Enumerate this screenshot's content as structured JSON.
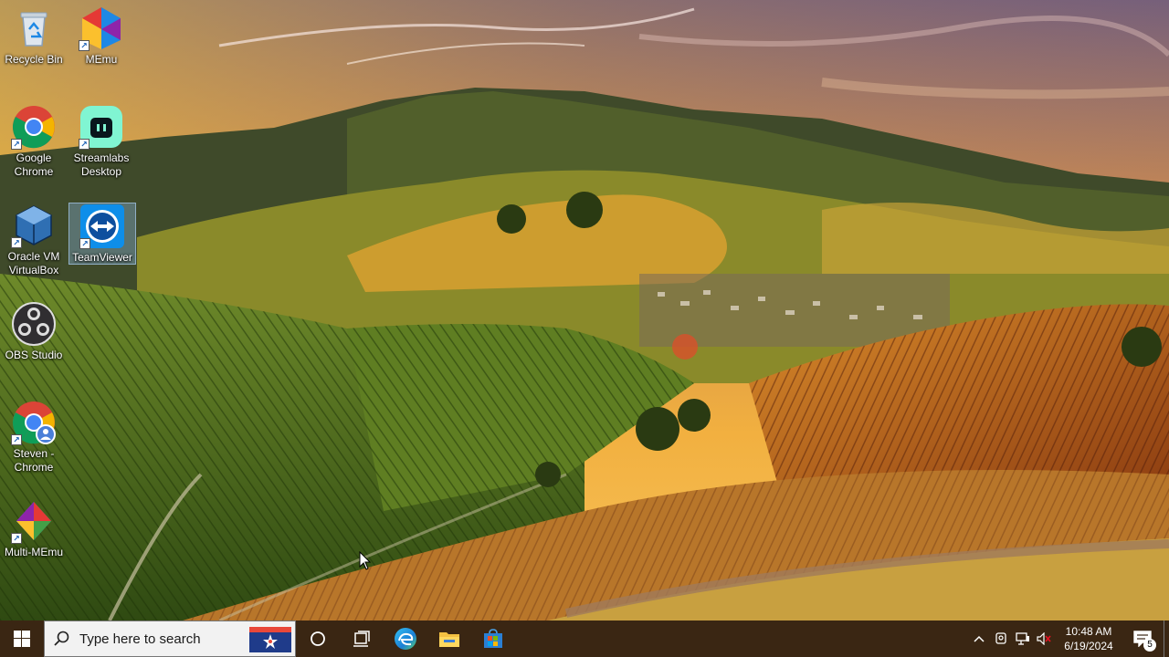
{
  "desktop": {
    "icons": [
      {
        "label": "Recycle Bin"
      },
      {
        "label": "MEmu"
      },
      {
        "label": "Google Chrome"
      },
      {
        "label": "Streamlabs Desktop"
      },
      {
        "label": "Oracle VM VirtualBox"
      },
      {
        "label": "TeamViewer"
      },
      {
        "label": "OBS Studio"
      },
      {
        "label": "Steven - Chrome"
      },
      {
        "label": "Multi-MEmu"
      }
    ]
  },
  "taskbar": {
    "search_placeholder": "Type here to search",
    "pinned": [
      {
        "icon": "cortana-circle-icon"
      },
      {
        "icon": "task-view-icon"
      },
      {
        "icon": "edge-icon"
      },
      {
        "icon": "file-explorer-icon"
      },
      {
        "icon": "microsoft-store-icon"
      }
    ],
    "clock": {
      "time": "10:48 AM",
      "date": "6/19/2024"
    },
    "notification_count": "5"
  },
  "colors": {
    "taskbar_bg": "#3a2613",
    "search_bg": "#f2f2f2",
    "accent": "#0078d7"
  }
}
